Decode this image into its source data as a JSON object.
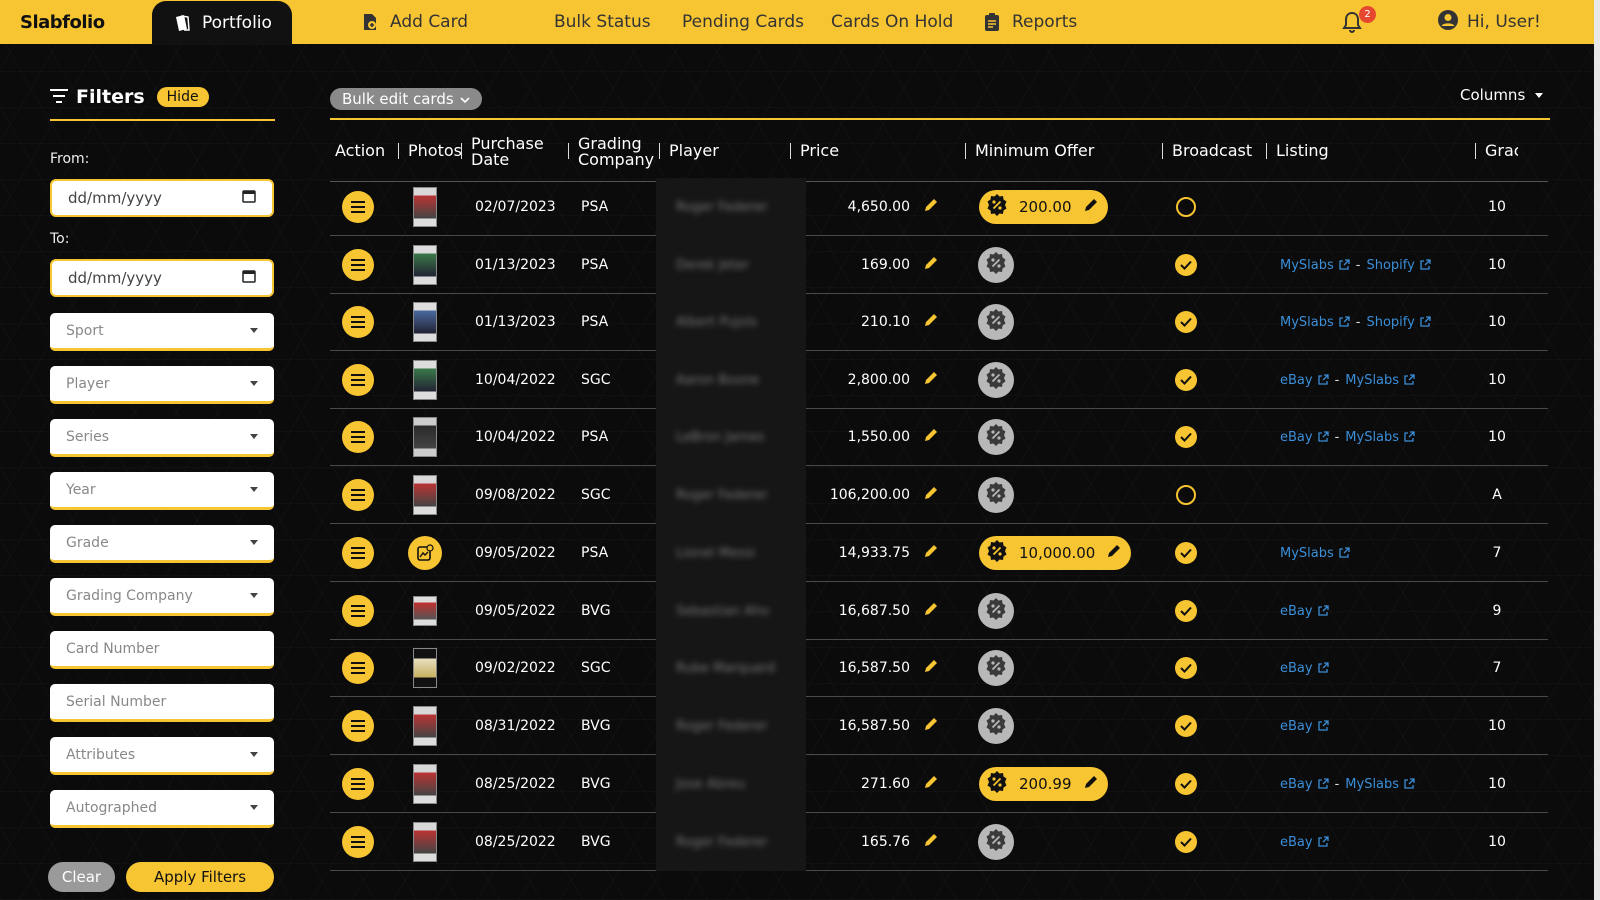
{
  "nav": {
    "brand": "Slabfolio",
    "portfolio": "Portfolio",
    "add_card": "Add Card",
    "bulk_status": "Bulk Status",
    "pending_cards": "Pending Cards",
    "cards_on_hold": "Cards On Hold",
    "reports": "Reports",
    "notification_count": "2",
    "greeting": "Hi, User!"
  },
  "filters": {
    "title": "Filters",
    "hide": "Hide",
    "from_label": "From:",
    "to_label": "To:",
    "date_placeholder": "dd/mm/yyyy",
    "sport": "Sport",
    "player": "Player",
    "series": "Series",
    "year": "Year",
    "grade": "Grade",
    "grading_company": "Grading Company",
    "card_number": "Card Number",
    "serial_number": "Serial Number",
    "attributes": "Attributes",
    "autographed": "Autographed",
    "clear": "Clear",
    "apply": "Apply Filters"
  },
  "toolbar": {
    "bulk_edit": "Bulk edit cards",
    "columns": "Columns"
  },
  "table": {
    "headers": {
      "action": "Action",
      "photos": "Photos",
      "purchase_date_1": "Purchase",
      "purchase_date_2": "Date",
      "grading_company_1": "Grading",
      "grading_company_2": "Company",
      "player": "Player",
      "price": "Price",
      "minimum_offer": "Minimum Offer",
      "broadcast": "Broadcast",
      "listing": "Listing",
      "grade": "Grac"
    },
    "rows": [
      {
        "date": "02/07/2023",
        "company": "PSA",
        "player": "Roger Federer",
        "price": "4,650.00",
        "offer": "200.00",
        "broadcast": false,
        "listing": [],
        "grade": "10"
      },
      {
        "date": "01/13/2023",
        "company": "PSA",
        "player": "Derek Jeter",
        "price": "169.00",
        "offer": "",
        "broadcast": true,
        "listing": [
          "MySlabs",
          "Shopify"
        ],
        "grade": "10"
      },
      {
        "date": "01/13/2023",
        "company": "PSA",
        "player": "Albert Pujols",
        "price": "210.10",
        "offer": "",
        "broadcast": true,
        "listing": [
          "MySlabs",
          "Shopify"
        ],
        "grade": "10"
      },
      {
        "date": "10/04/2022",
        "company": "SGC",
        "player": "Aaron Boone",
        "price": "2,800.00",
        "offer": "",
        "broadcast": true,
        "listing": [
          "eBay",
          "MySlabs"
        ],
        "grade": "10"
      },
      {
        "date": "10/04/2022",
        "company": "PSA",
        "player": "LeBron James",
        "price": "1,550.00",
        "offer": "",
        "broadcast": true,
        "listing": [
          "eBay",
          "MySlabs"
        ],
        "grade": "10"
      },
      {
        "date": "09/08/2022",
        "company": "SGC",
        "player": "Roger Federer",
        "price": "106,200.00",
        "offer": "",
        "broadcast": false,
        "listing": [],
        "grade": "A"
      },
      {
        "date": "09/05/2022",
        "company": "PSA",
        "player": "Lionel Messi",
        "price": "14,933.75",
        "offer": "10,000.00",
        "broadcast": true,
        "listing": [
          "MySlabs"
        ],
        "grade": "7"
      },
      {
        "date": "09/05/2022",
        "company": "BVG",
        "player": "Sebastian Aho",
        "price": "16,687.50",
        "offer": "",
        "broadcast": true,
        "listing": [
          "eBay"
        ],
        "grade": "9"
      },
      {
        "date": "09/02/2022",
        "company": "SGC",
        "player": "Rube Marquard",
        "price": "16,587.50",
        "offer": "",
        "broadcast": true,
        "listing": [
          "eBay"
        ],
        "grade": "7"
      },
      {
        "date": "08/31/2022",
        "company": "BVG",
        "player": "Roger Federer",
        "price": "16,587.50",
        "offer": "",
        "broadcast": true,
        "listing": [
          "eBay"
        ],
        "grade": "10"
      },
      {
        "date": "08/25/2022",
        "company": "BVG",
        "player": "Jose Abreu",
        "price": "271.60",
        "offer": "200.99",
        "broadcast": true,
        "listing": [
          "eBay",
          "MySlabs"
        ],
        "grade": "10"
      },
      {
        "date": "08/25/2022",
        "company": "BVG",
        "player": "Roger Federer",
        "price": "165.76",
        "offer": "",
        "broadcast": true,
        "listing": [
          "eBay"
        ],
        "grade": "10"
      }
    ]
  },
  "colors": {
    "accent": "#f7c432",
    "link": "#3b8ed8",
    "badge": "#e6482f"
  }
}
